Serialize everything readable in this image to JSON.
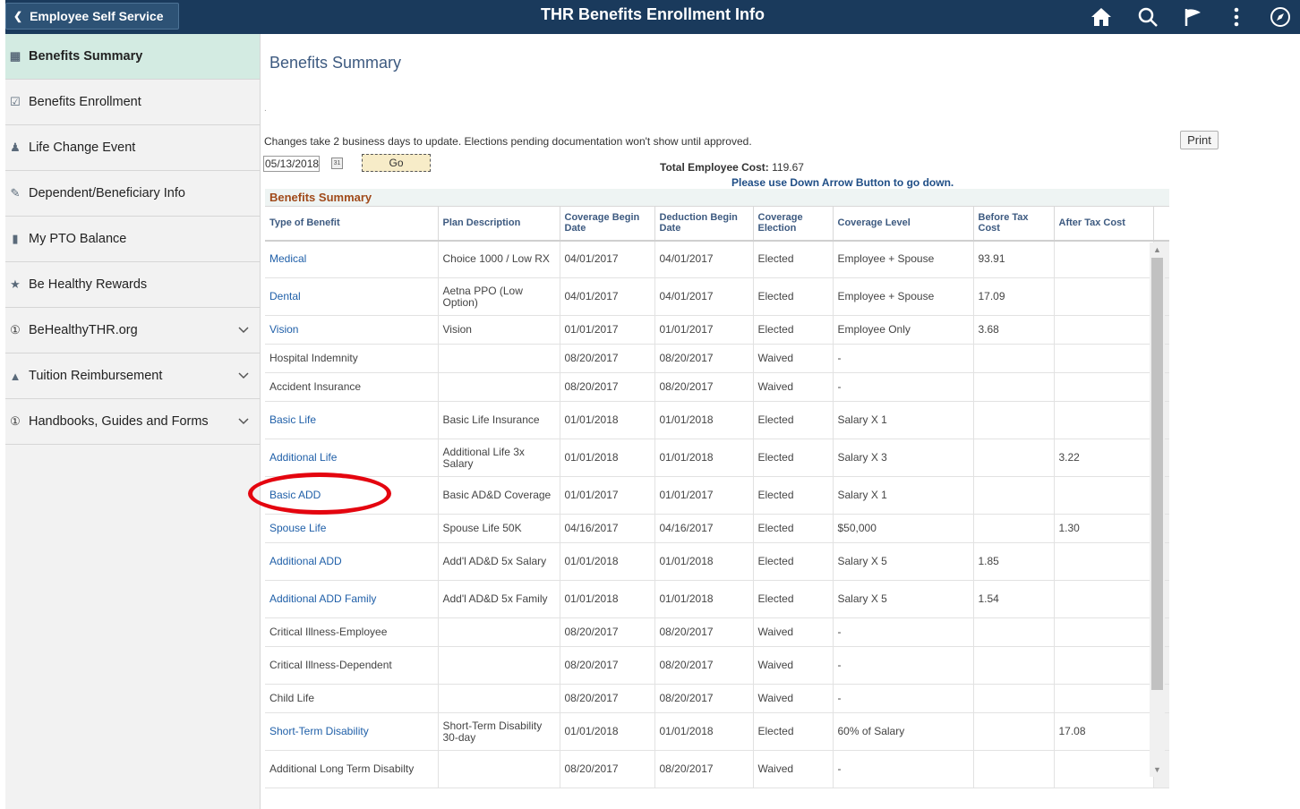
{
  "header": {
    "back_label": "Employee Self Service",
    "title": "THR Benefits Enrollment Info"
  },
  "icons": {
    "back": "chevron-left-icon",
    "home": "home-icon",
    "search": "search-icon",
    "flag": "flag-icon",
    "more": "more-vertical-icon",
    "compass": "compass-icon"
  },
  "sidebar": {
    "items": [
      {
        "label": "Benefits Summary",
        "icon": "benefits-summary-icon",
        "active": true,
        "expandable": false
      },
      {
        "label": "Benefits Enrollment",
        "icon": "enrollment-icon",
        "expandable": false
      },
      {
        "label": "Life Change Event",
        "icon": "family-icon",
        "expandable": false
      },
      {
        "label": "Dependent/Beneficiary Info",
        "icon": "dependent-icon",
        "expandable": false
      },
      {
        "label": "My PTO Balance",
        "icon": "pto-icon",
        "expandable": false
      },
      {
        "label": "Be Healthy Rewards",
        "icon": "rewards-icon",
        "expandable": false
      },
      {
        "label": "BeHealthyTHR.org",
        "icon": "info-icon",
        "expandable": true
      },
      {
        "label": "Tuition Reimbursement",
        "icon": "graduation-icon",
        "expandable": true
      },
      {
        "label": "Handbooks, Guides and Forms",
        "icon": "info-icon",
        "expandable": true
      }
    ]
  },
  "main": {
    "page_title": "Benefits Summary",
    "dot": ".",
    "notice": "Changes take 2 business days to update. Elections pending documentation won't show until approved.",
    "print_label": "Print",
    "date_value": "05/13/2018",
    "calendar_glyph": "31",
    "go_label": "Go",
    "total_cost_label": "Total Employee Cost:",
    "total_cost_value": "119.67",
    "down_note": "Please use Down Arrow Button to go down.",
    "grid_title": "Benefits Summary",
    "columns": [
      "Type of Benefit",
      "Plan Description",
      "Coverage Begin Date",
      "Deduction Begin Date",
      "Coverage Election",
      "Coverage Level",
      "Before Tax Cost",
      "After Tax Cost"
    ],
    "rows": [
      {
        "type": "Medical",
        "link": true,
        "plan": "Choice 1000 / Low RX",
        "cov_begin": "04/01/2017",
        "ded_begin": "04/01/2017",
        "election": "Elected",
        "level": "Employee + Spouse",
        "before_tax": "93.91",
        "after_tax": ""
      },
      {
        "type": "Dental",
        "link": true,
        "plan": "Aetna PPO (Low Option)",
        "cov_begin": "04/01/2017",
        "ded_begin": "04/01/2017",
        "election": "Elected",
        "level": "Employee + Spouse",
        "before_tax": "17.09",
        "after_tax": ""
      },
      {
        "type": "Vision",
        "link": true,
        "plan": "Vision",
        "cov_begin": "01/01/2017",
        "ded_begin": "01/01/2017",
        "election": "Elected",
        "level": "Employee Only",
        "before_tax": "3.68",
        "after_tax": ""
      },
      {
        "type": "Hospital Indemnity",
        "link": false,
        "plan": "",
        "cov_begin": "08/20/2017",
        "ded_begin": "08/20/2017",
        "election": "Waived",
        "level": "-",
        "before_tax": "",
        "after_tax": ""
      },
      {
        "type": "Accident Insurance",
        "link": false,
        "plan": "",
        "cov_begin": "08/20/2017",
        "ded_begin": "08/20/2017",
        "election": "Waived",
        "level": "-",
        "before_tax": "",
        "after_tax": ""
      },
      {
        "type": "Basic Life",
        "link": true,
        "plan": "Basic Life Insurance",
        "cov_begin": "01/01/2018",
        "ded_begin": "01/01/2018",
        "election": "Elected",
        "level": "Salary X 1",
        "before_tax": "",
        "after_tax": ""
      },
      {
        "type": "Additional Life",
        "link": true,
        "plan": "Additional Life 3x Salary",
        "cov_begin": "01/01/2018",
        "ded_begin": "01/01/2018",
        "election": "Elected",
        "level": "Salary X 3",
        "before_tax": "",
        "after_tax": "3.22"
      },
      {
        "type": "Basic ADD",
        "link": true,
        "plan": "Basic AD&D Coverage",
        "cov_begin": "01/01/2017",
        "ded_begin": "01/01/2017",
        "election": "Elected",
        "level": "Salary X 1",
        "before_tax": "",
        "after_tax": ""
      },
      {
        "type": "Spouse Life",
        "link": true,
        "plan": "Spouse Life 50K",
        "cov_begin": "04/16/2017",
        "ded_begin": "04/16/2017",
        "election": "Elected",
        "level": "$50,000",
        "before_tax": "",
        "after_tax": "1.30"
      },
      {
        "type": "Additional ADD",
        "link": true,
        "plan": "Add'l AD&D 5x Salary",
        "cov_begin": "01/01/2018",
        "ded_begin": "01/01/2018",
        "election": "Elected",
        "level": "Salary X 5",
        "before_tax": "1.85",
        "after_tax": ""
      },
      {
        "type": "Additional ADD Family",
        "link": true,
        "plan": "Add'l AD&D 5x Family",
        "cov_begin": "01/01/2018",
        "ded_begin": "01/01/2018",
        "election": "Elected",
        "level": "Salary X 5",
        "before_tax": "1.54",
        "after_tax": ""
      },
      {
        "type": "Critical Illness-Employee",
        "link": false,
        "plan": "",
        "cov_begin": "08/20/2017",
        "ded_begin": "08/20/2017",
        "election": "Waived",
        "level": "-",
        "before_tax": "",
        "after_tax": ""
      },
      {
        "type": "Critical Illness-Dependent",
        "link": false,
        "plan": "",
        "cov_begin": "08/20/2017",
        "ded_begin": "08/20/2017",
        "election": "Waived",
        "level": "-",
        "before_tax": "",
        "after_tax": ""
      },
      {
        "type": "Child Life",
        "link": false,
        "plan": "",
        "cov_begin": "08/20/2017",
        "ded_begin": "08/20/2017",
        "election": "Waived",
        "level": "-",
        "before_tax": "",
        "after_tax": ""
      },
      {
        "type": "Short-Term Disability",
        "link": true,
        "plan": "Short-Term Disability 30-day",
        "cov_begin": "01/01/2018",
        "ded_begin": "01/01/2018",
        "election": "Elected",
        "level": "60% of Salary",
        "before_tax": "",
        "after_tax": "17.08"
      },
      {
        "type": "Additional Long Term Disabilty",
        "link": false,
        "plan": "",
        "cov_begin": "08/20/2017",
        "ded_begin": "08/20/2017",
        "election": "Waived",
        "level": "-",
        "before_tax": "",
        "after_tax": ""
      }
    ]
  },
  "colors": {
    "header_bg": "#1a3a5c",
    "active_nav_bg": "#d3ebe2",
    "link": "#1f5fa8",
    "grid_title": "#a04a1a",
    "annotation_circle": "#e4050f"
  }
}
